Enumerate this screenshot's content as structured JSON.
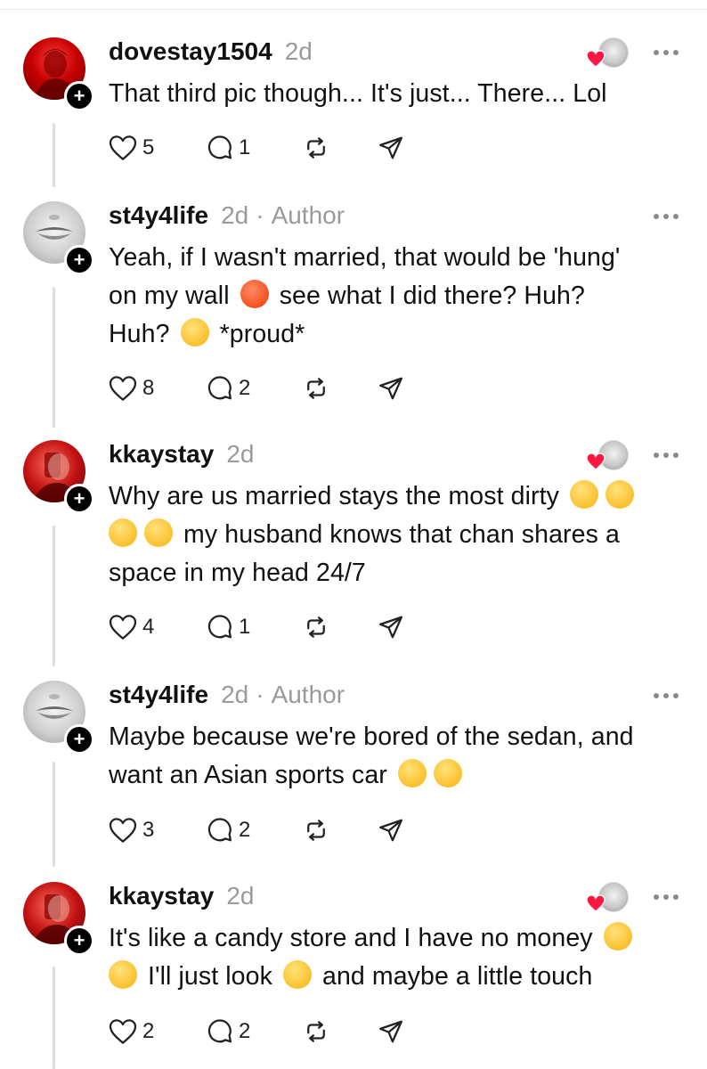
{
  "posts": [
    {
      "username": "dovestay1504",
      "time": "2d",
      "author_badge": "",
      "lines": [
        "That third pic though... It's just... There... Lol"
      ],
      "likes": "5",
      "replies": "1",
      "liked_by_author": true
    },
    {
      "username": "st4y4life",
      "time": "2d",
      "author_badge": "Author",
      "lines": [
        "Yeah, if I wasn't married, that would be 'hung'",
        "on my wall",
        "see what I did there? Huh?",
        "Huh?",
        "*proud*"
      ],
      "likes": "8",
      "replies": "2",
      "liked_by_author": false
    },
    {
      "username": "kkaystay",
      "time": "2d",
      "author_badge": "",
      "lines": [
        "Why are us married stays the most dirty",
        "my husband knows that chan shares a",
        "space in my head 24/7"
      ],
      "likes": "4",
      "replies": "1",
      "liked_by_author": true
    },
    {
      "username": "st4y4life",
      "time": "2d",
      "author_badge": "Author",
      "lines": [
        "Maybe because we're bored of the sedan, and",
        "want an Asian sports car"
      ],
      "likes": "3",
      "replies": "2",
      "liked_by_author": false
    },
    {
      "username": "kkaystay",
      "time": "2d",
      "author_badge": "",
      "lines": [
        "It's like a candy store and I have no money",
        "I'll just look",
        "and maybe a little touch"
      ],
      "likes": "2",
      "replies": "2",
      "liked_by_author": true
    }
  ],
  "ui": {
    "author_separator": "·",
    "follow_symbol": "+",
    "colors": {
      "heart_red": "#ff1744",
      "muted_gray": "#9a9a9a",
      "text": "#111111",
      "thread_line": "#dedede"
    }
  },
  "icons": [
    "heart-icon",
    "comment-icon",
    "repost-icon",
    "share-icon",
    "more-icon",
    "follow-plus-icon"
  ]
}
